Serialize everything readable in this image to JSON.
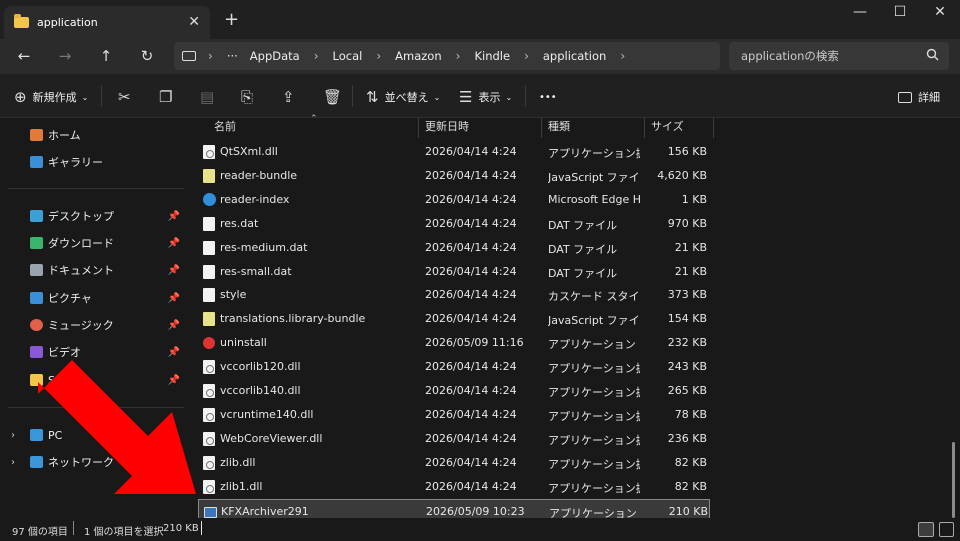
{
  "tab": {
    "title": "application",
    "close_glyph": "✕",
    "new_tab_glyph": "+"
  },
  "window_controls": {
    "minimize": "—",
    "maximize": "☐",
    "close": "✕"
  },
  "nav": {
    "back": "←",
    "forward": "→",
    "up": "↑",
    "refresh": "↻"
  },
  "address": {
    "ellipsis": "···",
    "separator": "›",
    "crumbs": [
      "AppData",
      "Local",
      "Amazon",
      "Kindle",
      "application"
    ]
  },
  "search": {
    "placeholder": "applicationの検索",
    "icon": "search-icon"
  },
  "toolbar": {
    "new_label": "新規作成",
    "sort_label": "並べ替え",
    "view_label": "表示",
    "more_label": "•••",
    "details_label": "詳細",
    "icons": [
      "cut-icon",
      "copy-icon",
      "paste-icon",
      "rename-icon",
      "share-icon",
      "delete-icon"
    ]
  },
  "sidebar": {
    "top_items": [
      {
        "label": "ホーム",
        "icon": "home-icon",
        "color": "#e07a3b"
      },
      {
        "label": "ギャラリー",
        "icon": "gallery-icon",
        "color": "#3b8fd6"
      }
    ],
    "pinned_items": [
      {
        "label": "デスクトップ",
        "icon": "desktop-icon",
        "color": "#3ca0d8"
      },
      {
        "label": "ダウンロード",
        "icon": "download-icon",
        "color": "#3bb36a"
      },
      {
        "label": "ドキュメント",
        "icon": "documents-icon",
        "color": "#9aa4b0"
      },
      {
        "label": "ピクチャ",
        "icon": "pictures-icon",
        "color": "#3b8fd6"
      },
      {
        "label": "ミュージック",
        "icon": "music-icon",
        "color": "#e0604a"
      },
      {
        "label": "ビデオ",
        "icon": "videos-icon",
        "color": "#8a5ad6"
      },
      {
        "label": "So",
        "icon": "folder-icon",
        "color": "#f3c54b"
      }
    ],
    "tree_items": [
      {
        "label": "PC",
        "icon": "pc-icon",
        "color": "#3a96d8"
      },
      {
        "label": "ネットワーク",
        "icon": "network-icon",
        "color": "#3a96d8"
      }
    ]
  },
  "columns": {
    "name": "名前",
    "date": "更新日時",
    "type": "種類",
    "size": "サイズ"
  },
  "files": [
    {
      "name": "QtSXml.dll",
      "date": "2026/04/14 4:24",
      "type": "アプリケーション拡張",
      "size": "156 KB",
      "icon": "dll"
    },
    {
      "name": "reader-bundle",
      "date": "2026/04/14 4:24",
      "type": "JavaScript ファイル",
      "size": "4,620 KB",
      "icon": "js"
    },
    {
      "name": "reader-index",
      "date": "2026/04/14 4:24",
      "type": "Microsoft Edge H...",
      "size": "1 KB",
      "icon": "edge"
    },
    {
      "name": "res.dat",
      "date": "2026/04/14 4:24",
      "type": "DAT ファイル",
      "size": "970 KB",
      "icon": "file"
    },
    {
      "name": "res-medium.dat",
      "date": "2026/04/14 4:24",
      "type": "DAT ファイル",
      "size": "21 KB",
      "icon": "file"
    },
    {
      "name": "res-small.dat",
      "date": "2026/04/14 4:24",
      "type": "DAT ファイル",
      "size": "21 KB",
      "icon": "file"
    },
    {
      "name": "style",
      "date": "2026/04/14 4:24",
      "type": "カスケード スタイル シ...",
      "size": "373 KB",
      "icon": "file"
    },
    {
      "name": "translations.library-bundle",
      "date": "2026/04/14 4:24",
      "type": "JavaScript ファイル",
      "size": "154 KB",
      "icon": "js"
    },
    {
      "name": "uninstall",
      "date": "2026/05/09 11:16",
      "type": "アプリケーション",
      "size": "232 KB",
      "icon": "err"
    },
    {
      "name": "vccorlib120.dll",
      "date": "2026/04/14 4:24",
      "type": "アプリケーション拡張",
      "size": "243 KB",
      "icon": "dll"
    },
    {
      "name": "vccorlib140.dll",
      "date": "2026/04/14 4:24",
      "type": "アプリケーション拡張",
      "size": "265 KB",
      "icon": "dll"
    },
    {
      "name": "vcruntime140.dll",
      "date": "2026/04/14 4:24",
      "type": "アプリケーション拡張",
      "size": "78 KB",
      "icon": "dll"
    },
    {
      "name": "WebCoreViewer.dll",
      "date": "2026/04/14 4:24",
      "type": "アプリケーション拡張",
      "size": "236 KB",
      "icon": "dll"
    },
    {
      "name": "zlib.dll",
      "date": "2026/04/14 4:24",
      "type": "アプリケーション拡張",
      "size": "82 KB",
      "icon": "dll"
    },
    {
      "name": "zlib1.dll",
      "date": "2026/04/14 4:24",
      "type": "アプリケーション拡張",
      "size": "82 KB",
      "icon": "dll"
    },
    {
      "name": "KFXArchiver291",
      "date": "2026/05/09 10:23",
      "type": "アプリケーション",
      "size": "210 KB",
      "icon": "exe",
      "selected": true
    }
  ],
  "status": {
    "count": "97 個の項目",
    "selected": "1 個の項目を選択",
    "size": "210 KB"
  },
  "colors": {
    "background": "#191919",
    "accent_arrow": "#ff0000",
    "folder": "#f3c54b"
  }
}
